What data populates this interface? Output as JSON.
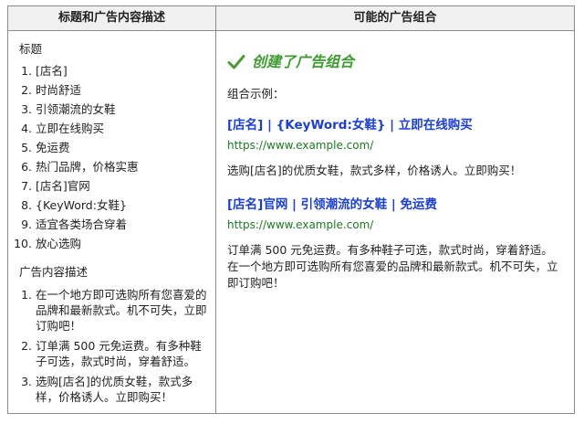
{
  "header": {
    "left": "标题和广告内容描述",
    "right": "可能的广告组合"
  },
  "left": {
    "headlines_title": "标题",
    "headlines": [
      "[店名]",
      "时尚舒适",
      "引领潮流的女鞋",
      "立即在线购买",
      "免运费",
      "热门品牌，价格实惠",
      "[店名]官网",
      "{KeyWord:女鞋}",
      "适宜各类场合穿着",
      "放心选购"
    ],
    "descriptions_title": "广告内容描述",
    "descriptions": [
      "在一个地方即可选购所有您喜爱的品牌和最新款式。机不可失，立即订购吧！",
      "订单满 500 元免运费。有多种鞋子可选，款式时尚，穿着舒适。",
      "选购[店名]的优质女鞋，款式多样，价格诱人。立即购买！"
    ]
  },
  "right": {
    "created": "创建了广告组合",
    "combo_label": "组合示例：",
    "ads": [
      {
        "title": "[店名] | {KeyWord:女鞋} | 立即在线购买",
        "url": "https://www.example.com/",
        "desc": "选购[店名]的优质女鞋，款式多样，价格诱人。立即购买！"
      },
      {
        "title": "[店名]官网 | 引领潮流的女鞋 | 免运费",
        "url": "https://www.example.com/",
        "desc": "订单满 500 元免运费。有多种鞋子可选，款式时尚，穿着舒适。在一个地方即可选购所有您喜爱的品牌和最新款式。机不可失，立即订购吧！"
      }
    ]
  },
  "icons": {
    "check": "checkmark-icon"
  },
  "colors": {
    "check": "#4a9a3a",
    "created_text": "#3d9b2f",
    "ad_title": "#1a3fd6",
    "ad_url": "#1a7a22"
  }
}
